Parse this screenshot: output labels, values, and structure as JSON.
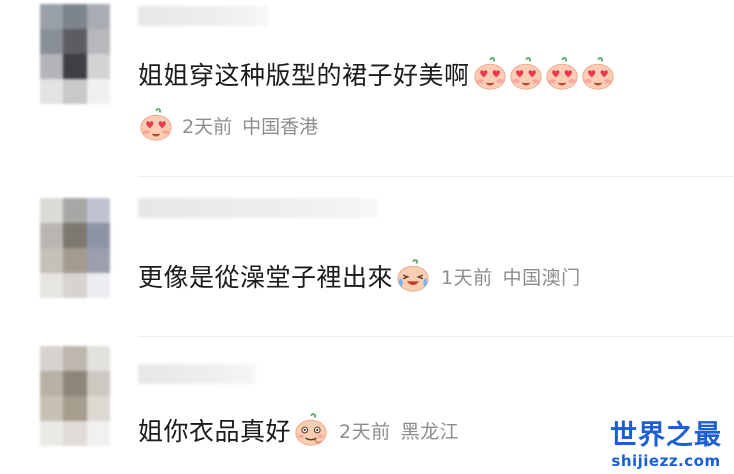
{
  "comments": [
    {
      "content": "姐姐穿这种版型的裙子好美啊",
      "content_emojis": [
        "heart-eyes-emoji",
        "heart-eyes-emoji",
        "heart-eyes-emoji",
        "heart-eyes-emoji"
      ],
      "meta_emoji": "heart-eyes-emoji",
      "time": "2天前",
      "location": "中国香港"
    },
    {
      "content": "更像是從澡堂子裡出來",
      "content_emoji": "crying-laughing-emoji",
      "time": "1天前",
      "location": "中国澳门"
    },
    {
      "content": "姐你衣品真好",
      "content_emoji": "smirk-emoji",
      "time": "2天前",
      "location": "黑龙江"
    }
  ],
  "watermark": {
    "title": "世界之最",
    "site": "shijiezz.com",
    "color": "#1a5fd8"
  },
  "colors": {
    "emoji_face": "#f9c5a8",
    "emoji_heart": "#e8384f",
    "meta_text": "#8d8d8d"
  }
}
